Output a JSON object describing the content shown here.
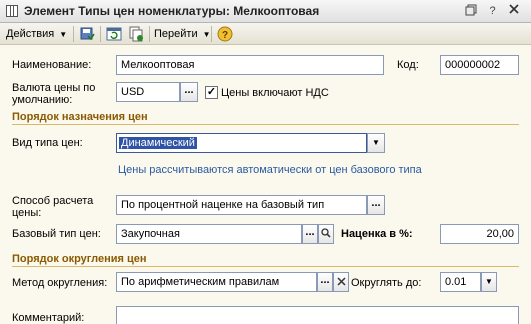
{
  "window": {
    "title": "Элемент Типы цен номенклатуры: Мелкооптовая"
  },
  "toolbar": {
    "actions_label": "Действия",
    "goto_label": "Перейти",
    "help_label": "?"
  },
  "form": {
    "name_label": "Наименование:",
    "name_value": "Мелкооптовая",
    "code_label": "Код:",
    "code_value": "000000002",
    "currency_label_1": "Валюта цены по",
    "currency_label_2": "умолчанию:",
    "currency_value": "USD",
    "vat_label": "Цены включают НДС",
    "vat_checked": true,
    "section_assign": "Порядок назначения цен",
    "price_kind_label": "Вид типа цен:",
    "price_kind_value": "Динамический",
    "auto_note": "Цены рассчитываются автоматически от цен базового типа",
    "calc_method_label_1": "Способ расчета",
    "calc_method_label_2": "цены:",
    "calc_method_value": "По процентной наценке на базовый тип",
    "base_type_label": "Базовый тип цен:",
    "base_type_value": "Закупочная",
    "markup_label": "Наценка в %:",
    "markup_value": "20,00",
    "section_round": "Порядок округления цен",
    "round_method_label": "Метод округления:",
    "round_method_value": "По арифметическим правилам",
    "round_to_label": "Округлять до:",
    "round_to_value": "0.01",
    "comment_label": "Комментарий:",
    "comment_value": ""
  },
  "colors": {
    "section": "#8b5a00",
    "note": "#2a5aa0",
    "selection": "#2f53a5"
  }
}
